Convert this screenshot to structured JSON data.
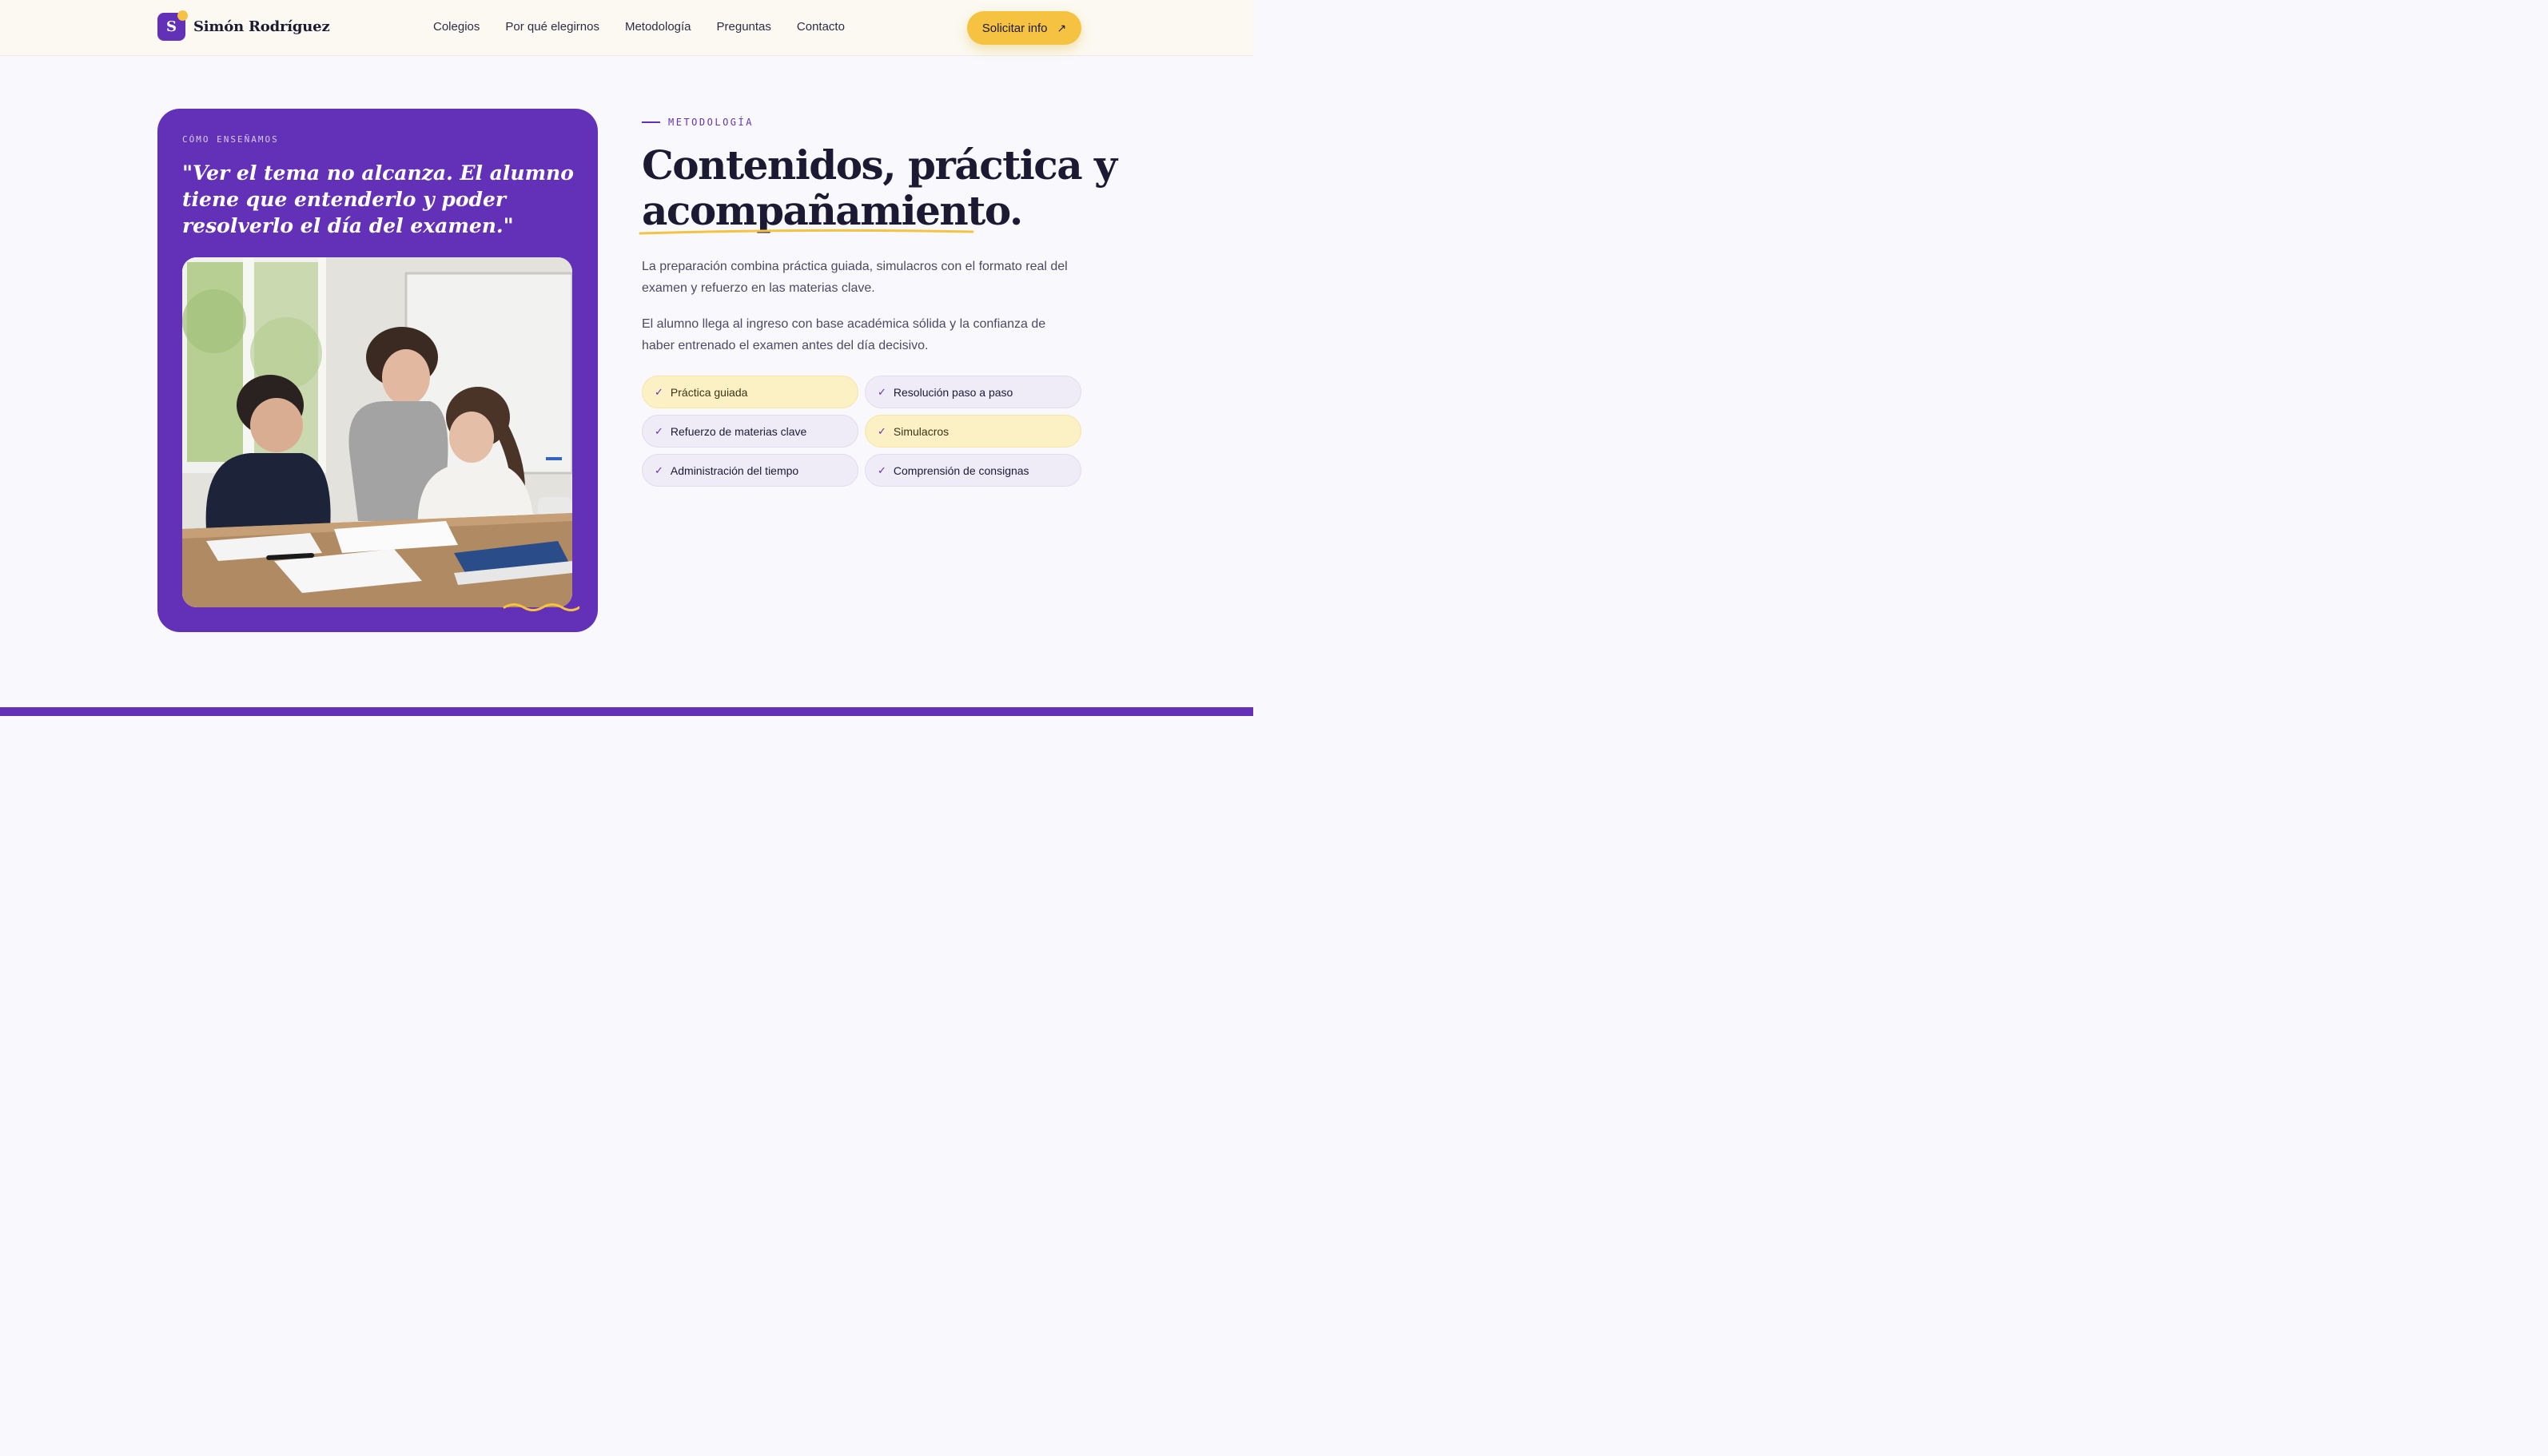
{
  "brand": {
    "initial": "S",
    "name": "Simón Rodríguez"
  },
  "nav": {
    "items": [
      {
        "label": "Colegios"
      },
      {
        "label": "Por qué elegirnos"
      },
      {
        "label": "Metodología"
      },
      {
        "label": "Preguntas"
      },
      {
        "label": "Contacto"
      }
    ]
  },
  "cta": {
    "label": "Solicitar info",
    "icon": "arrow-up-right-icon"
  },
  "card": {
    "eyebrow": "CÓMO ENSEÑAMOS",
    "quote": "\"Ver el tema no alcanza. El alumno tiene que entenderlo y poder resolverlo el día del examen.\"",
    "photo_subject": "teacher-helping-students-photo"
  },
  "section": {
    "eyebrow": "METODOLOGÍA",
    "title_line1": "Contenidos, práctica y",
    "title_line2": "acompañamiento.",
    "paragraph1": "La preparación combina práctica guiada, simulacros con el formato real del examen y refuerzo en las materias clave.",
    "paragraph2": "El alumno llega al ingreso con base académica sólida y la confianza de haber entrenado el examen antes del día decisivo.",
    "features": [
      {
        "label": "Práctica guiada",
        "highlight": true
      },
      {
        "label": "Resolución paso a paso",
        "highlight": false
      },
      {
        "label": "Refuerzo de materias clave",
        "highlight": false
      },
      {
        "label": "Simulacros",
        "highlight": true
      },
      {
        "label": "Administración del tiempo",
        "highlight": false
      },
      {
        "label": "Comprensión de consignas",
        "highlight": false
      }
    ]
  },
  "colors": {
    "primary": "#6331b7",
    "accent": "#f5c241",
    "background": "#f9f8fd",
    "header_bg": "#fbf9f1",
    "text": "#1c1a33"
  }
}
